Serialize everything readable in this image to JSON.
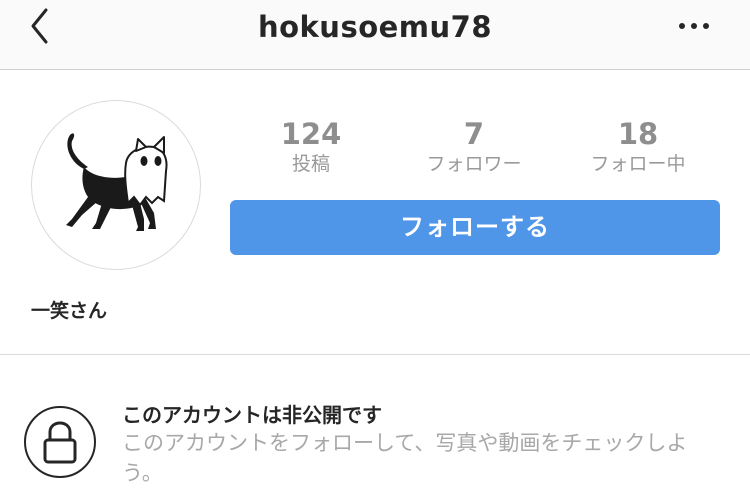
{
  "header": {
    "username": "hokusoemu78",
    "back_icon": "chevron-left-icon",
    "more_icon": "more-horizontal-icon"
  },
  "profile": {
    "avatar_icon": "ghost-cat-avatar",
    "display_name": "一笑さん",
    "stats": {
      "posts": {
        "value": "124",
        "label": "投稿"
      },
      "followers": {
        "value": "7",
        "label": "フォロワー"
      },
      "following": {
        "value": "18",
        "label": "フォロー中"
      }
    },
    "follow_button_label": "フォローする"
  },
  "private_notice": {
    "icon": "lock-icon",
    "title": "このアカウントは非公開です",
    "description": "このアカウントをフォローして、写真や動画をチェックしよう。"
  },
  "colors": {
    "accent": "#4f95e8",
    "header_bg": "#fafafa",
    "text": "#262626",
    "muted": "#a8a8a8"
  }
}
